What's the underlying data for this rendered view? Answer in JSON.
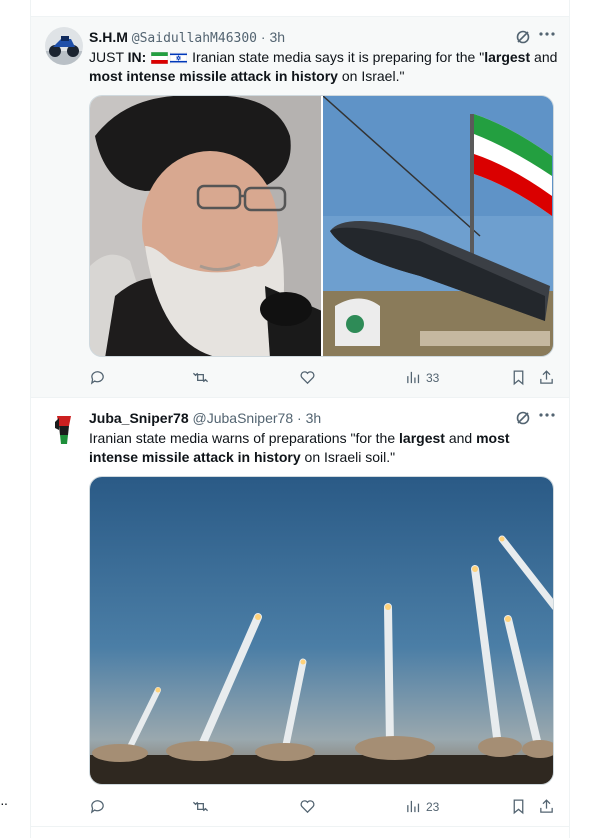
{
  "posts": [
    {
      "name": "S.H.M",
      "handle": "@SaidullahM46300",
      "time": "3h",
      "text_parts": [
        "JUST ",
        "IN:",
        " Iranian state media says it is preparing for the \"",
        "largest",
        " and ",
        "most intense missile attack in history",
        " on Israel.\""
      ],
      "views": "33"
    },
    {
      "name": "Juba_Sniper78",
      "handle": "@JubaSniper78",
      "time": "3h",
      "text_parts": [
        "Iranian state media warns of preparations \"for the ",
        "largest",
        " and ",
        "most",
        " ",
        "intense missile attack in history",
        " on Israeli soil.\""
      ],
      "views": "23"
    }
  ],
  "separator": "·",
  "side_dots": "··",
  "colors": {
    "icon_gray": "#536471",
    "border": "#eff3f4",
    "hover_bg": "#f7f9f9"
  }
}
